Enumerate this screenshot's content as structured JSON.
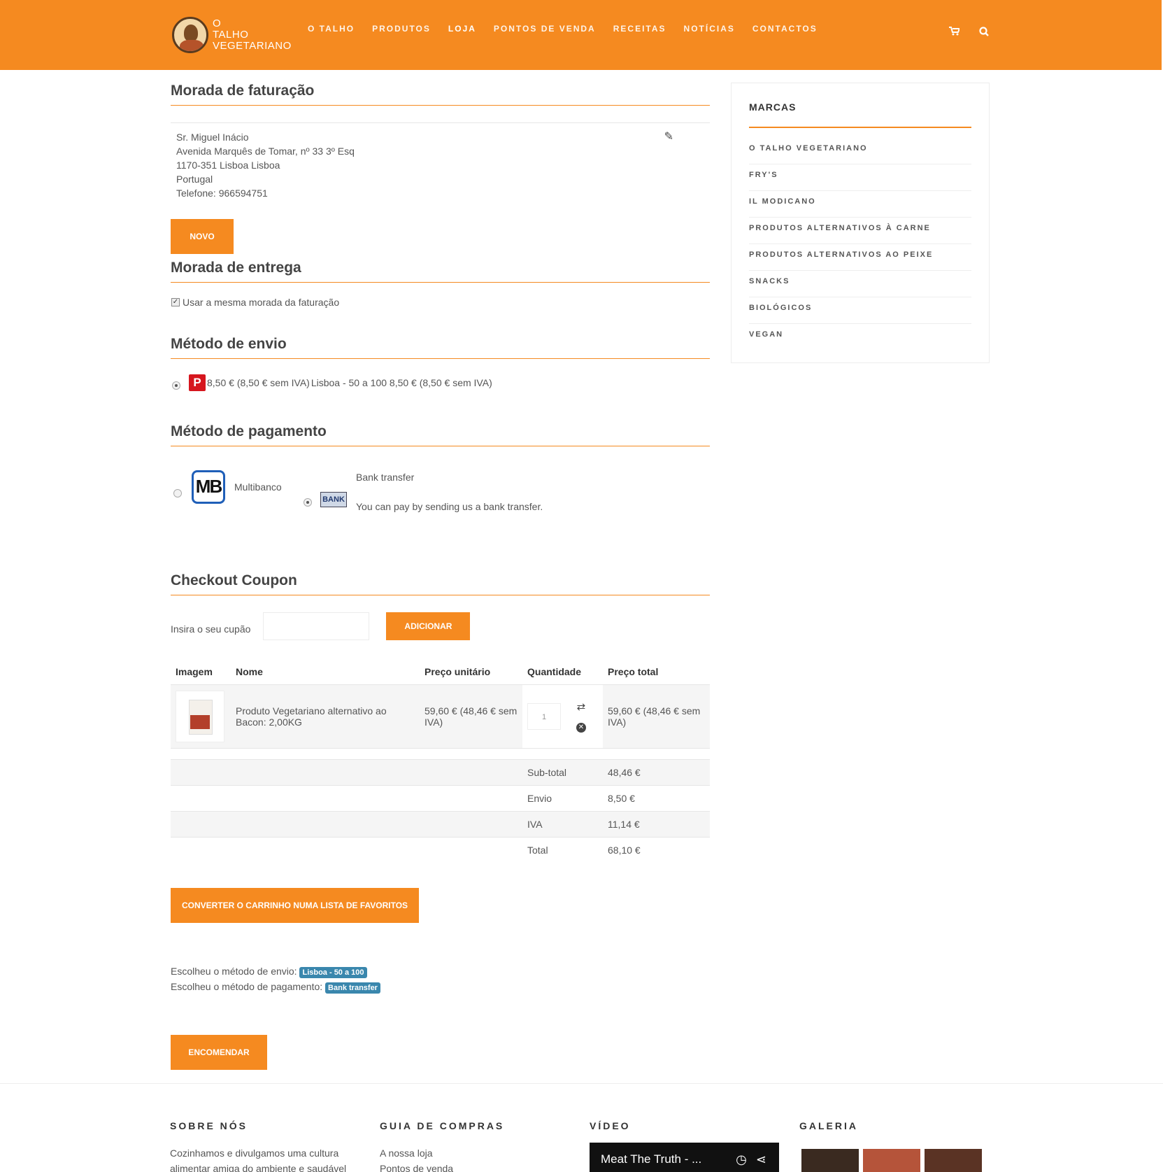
{
  "header": {
    "logo_lines": [
      "O",
      "TALHO",
      "VEGETARIANO"
    ],
    "nav": [
      "O TALHO",
      "PRODUTOS",
      "LOJA",
      "PONTOS DE VENDA",
      "RECEITAS",
      "NOTÍCIAS",
      "CONTACTOS"
    ],
    "cart_icon": "cart-icon",
    "search_icon": "search-icon"
  },
  "billing": {
    "title": "Morada de faturação",
    "address": [
      "Sr. Miguel Inácio",
      "Avenida Marquês de Tomar, nº 33 3º Esq",
      "1170-351 Lisboa Lisboa",
      "Portugal",
      "Telefone: 966594751"
    ],
    "new_label": "NOVO"
  },
  "shipping_address": {
    "title": "Morada de entrega",
    "same_label": "Usar a mesma morada da faturação",
    "same_checked": true
  },
  "shipping_method": {
    "title": "Método de envio",
    "option_price": "8,50 € (8,50 € sem IVA)",
    "option_label": "Lisboa - 50 a 100 8,50 € (8,50 € sem IVA)",
    "logo_letter": "P"
  },
  "payment_method": {
    "title": "Método de pagamento",
    "mb_logo": "MB",
    "mb_label": "Multibanco",
    "bank_logo": "BANK",
    "bank_label": "Bank transfer",
    "bank_desc": "You can pay by sending us a bank transfer."
  },
  "coupon": {
    "title": "Checkout Coupon",
    "label": "Insira o seu cupão",
    "value": "",
    "add_label": "ADICIONAR"
  },
  "cart": {
    "headers": [
      "Imagem",
      "Nome",
      "Preço unitário",
      "Quantidade",
      "Preço total"
    ],
    "item": {
      "name": "Produto Vegetariano alternativo ao Bacon: 2,00KG",
      "unit_price": "59,60 € (48,46 € sem IVA)",
      "quantity": "1",
      "total_price": "59,60 € (48,46 € sem IVA)"
    },
    "totals": [
      {
        "label": "Sub-total",
        "value": "48,46 €"
      },
      {
        "label": "Envio",
        "value": "8,50 €"
      },
      {
        "label": "IVA",
        "value": "11,14 €"
      },
      {
        "label": "Total",
        "value": "68,10 €"
      }
    ],
    "convert_label": "CONVERTER O CARRINHO NUMA LISTA DE FAVORITOS"
  },
  "summary": {
    "ship_text": "Escolheu o método de envio:",
    "ship_tag": "Lisboa - 50 a 100",
    "pay_text": "Escolheu o método de pagamento:",
    "pay_tag": "Bank transfer",
    "order_label": "ENCOMENDAR"
  },
  "sidebar": {
    "title": "MARCAS",
    "brands": [
      "O TALHO VEGETARIANO",
      "FRY'S",
      "IL MODICANO",
      "PRODUTOS ALTERNATIVOS À CARNE",
      "PRODUTOS ALTERNATIVOS AO PEIXE",
      "SNACKS",
      "BIOLÓGICOS",
      "VEGAN"
    ]
  },
  "footer": {
    "about_title": "SOBRE NÓS",
    "about_text": [
      "Cozinhamos e divulgamos uma cultura",
      "alimentar amiga do ambiente e saudável"
    ],
    "guide_title": "GUIA DE COMPRAS",
    "guide_links": [
      "A nossa loja",
      "Pontos de venda"
    ],
    "video_title": "VÍDEO",
    "video_caption": "Meat The Truth - ...",
    "gallery_title": "GALERIA"
  },
  "colors": {
    "accent": "#f58a20",
    "tag": "#3a87ad"
  }
}
